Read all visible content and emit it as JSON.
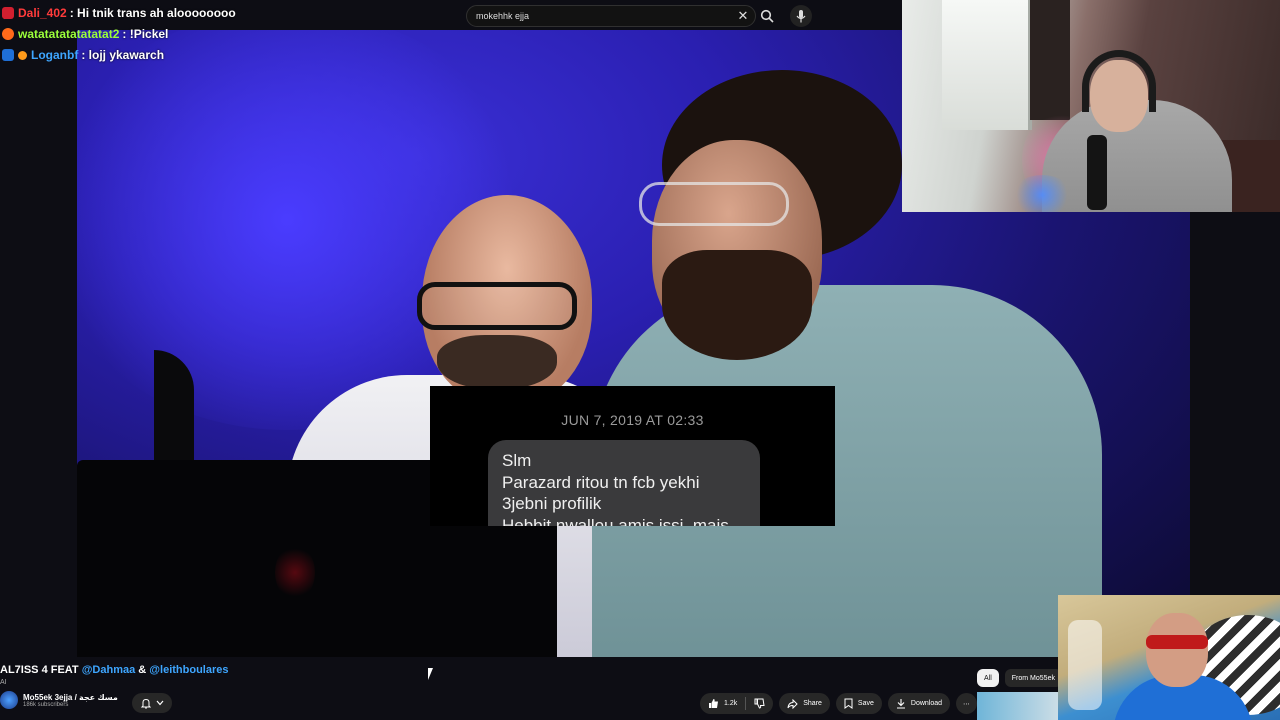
{
  "chat": [
    {
      "user": "Dali_402",
      "text": ": Hi tnik trans ah aloooooooo",
      "color": "#ff3b3b",
      "badge": "#d21f2f"
    },
    {
      "user": "watatatatatatatat2",
      "text": ": !Pickel",
      "color": "#9bff3a",
      "badge": "#ff6a1a"
    },
    {
      "user": "Loganbf",
      "text": ": lojj ykawarch",
      "color": "#3ea6ff",
      "badge": "#1f6fd6"
    }
  ],
  "search": {
    "query": "mokehhk ejja"
  },
  "message": {
    "date": "JUN 7, 2019 AT 02:33",
    "lines": [
      "Slm",
      "Parazard ritou tn fcb yekhi",
      "3jebni profilik",
      "Hebbit nwallou amis issi, mais"
    ]
  },
  "video": {
    "title_prefix": "AL7ISS 4 FEAT ",
    "mention1": "@Dahmaa",
    "amp": " & ",
    "mention2": "@leithboulares",
    "ai_tag": "AI"
  },
  "channel": {
    "name": "Mo55ek 3ejja / مسك عجة",
    "subscribers": "186k subscribers"
  },
  "actions": {
    "likes": "1.2k",
    "share": "Share",
    "save": "Save",
    "download": "Download"
  },
  "chips": {
    "all": "All",
    "from": "From Mo55ek"
  },
  "colors": {
    "accent": "#3ea6ff",
    "bubble": "#3a3a3c",
    "purple_bg": "#2a1fb0"
  }
}
